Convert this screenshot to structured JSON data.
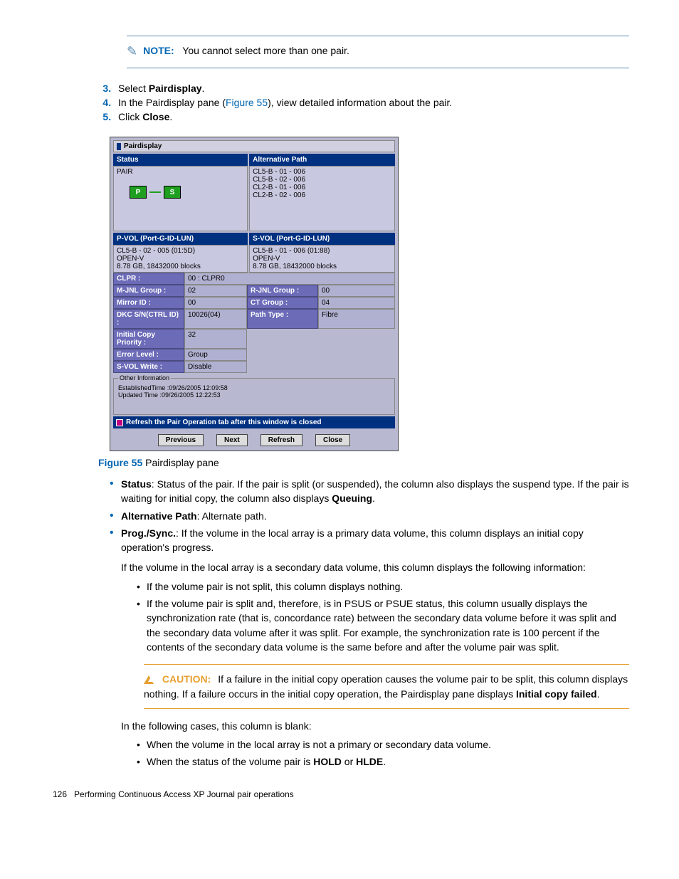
{
  "note": {
    "label": "NOTE:",
    "text": "You cannot select more than one pair."
  },
  "steps": [
    {
      "num": "3.",
      "pre": "Select ",
      "bold": "Pairdisplay",
      "post": "."
    },
    {
      "num": "4.",
      "pre": "In the Pairdisplay pane (",
      "link": "Figure 55",
      "mid": "), view detailed information about the pair.",
      "bold": "",
      "post": ""
    },
    {
      "num": "5.",
      "pre": "Click ",
      "bold": "Close",
      "post": "."
    }
  ],
  "pd": {
    "title": "Pairdisplay",
    "status_h": "Status",
    "altpath_h": "Alternative Path",
    "status_val": "PAIR",
    "altpaths": [
      "CL5-B - 01 - 006",
      "CL5-B - 02 - 006",
      "CL2-B - 01 - 006",
      "CL2-B - 02 - 006"
    ],
    "p": "P",
    "s": "S",
    "pvol_h": "P-VOL (Port-G-ID-LUN)",
    "svol_h": "S-VOL (Port-G-ID-LUN)",
    "pvol": [
      "CL5-B - 02 - 005 (01:5D)",
      "OPEN-V",
      "8.78 GB, 18432000 blocks"
    ],
    "svol": [
      "CL5-B - 01 - 006 (01:88)",
      "OPEN-V",
      "8.78 GB, 18432000 blocks"
    ],
    "clpr_l": "CLPR :",
    "clpr_v": "00 : CLPR0",
    "mjnl_l": "M-JNL Group :",
    "mjnl_v": "02",
    "rjnl_l": "R-JNL Group :",
    "rjnl_v": "00",
    "mirror_l": "Mirror ID :",
    "mirror_v": "00",
    "ct_l": "CT Group :",
    "ct_v": "04",
    "dkc_l": "DKC S/N(CTRL ID) :",
    "dkc_v": "10026(04)",
    "path_l": "Path Type :",
    "path_v": "Fibre",
    "icp_l": "Initial Copy Priority :",
    "icp_v": "32",
    "err_l": "Error Level :",
    "err_v": "Group",
    "svw_l": "S-VOL Write :",
    "svw_v": "Disable",
    "other_legend": "Other Information",
    "other1": "EstablishedTime :09/26/2005 12:09:58",
    "other2": "Updated Time :09/26/2005 12:22:53",
    "refresh_chk": "Refresh the Pair Operation tab after this window is closed",
    "btns": [
      "Previous",
      "Next",
      "Refresh",
      "Close"
    ]
  },
  "fig": {
    "label": "Figure 55",
    "caption": " Pairdisplay pane"
  },
  "defs": {
    "status": {
      "term": "Status",
      "text": ": Status of the pair. If the pair is split (or suspended), the column also displays the suspend type. If the pair is waiting for initial copy, the column also displays ",
      "bold": "Queuing",
      "post": "."
    },
    "altpath": {
      "term": "Alternative Path",
      "text": ": Alternate path."
    },
    "prog": {
      "term": "Prog./Sync.",
      "text": ": If the volume in the local array is a primary data volume, this column displays an initial copy operation's progress.",
      "p2": "If the volume in the local array is a secondary data volume, this column displays the following information:",
      "sub1": "If the volume pair is not split, this column displays nothing.",
      "sub2": "If the volume pair is split and, therefore, is in PSUS or PSUE status, this column usually displays the synchronization rate (that is, concordance rate) between the secondary data volume before it was split and the secondary data volume after it was split. For example, the synchronization rate is 100 percent if the contents of the secondary data volume is the same before and after the volume pair was split."
    }
  },
  "caution": {
    "label": "CAUTION:",
    "text": "If a failure in the initial copy operation causes the volume pair to be split, this column displays nothing. If a failure occurs in the initial copy operation, the Pairdisplay pane displays ",
    "bold": "Initial copy failed",
    "post": "."
  },
  "after": {
    "p": "In the following cases, this column is blank:",
    "b1": "When the volume in the local array is not a primary or secondary data volume.",
    "b2_pre": "When the status of the volume pair is ",
    "b2_b1": "HOLD",
    "b2_mid": " or ",
    "b2_b2": "HLDE",
    "b2_post": "."
  },
  "footer": {
    "num": "126",
    "text": "Performing Continuous Access XP Journal pair operations"
  }
}
